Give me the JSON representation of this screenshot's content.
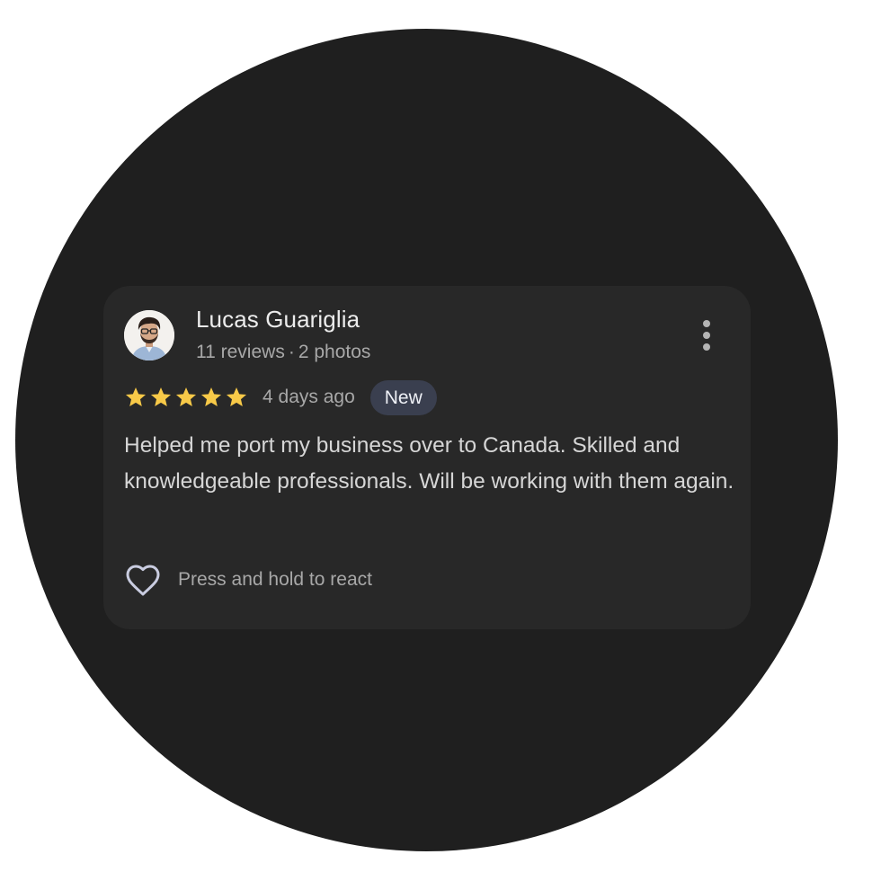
{
  "reviewer": {
    "name": "Lucas Guariglia",
    "reviews_count": "11 reviews",
    "separator": "·",
    "photos_count": "2 photos"
  },
  "rating": {
    "stars": 5,
    "max_stars": 5,
    "time_ago": "4 days ago",
    "badge": "New"
  },
  "review": {
    "text": "Helped me port my business over to Canada. Skilled and knowledgeable professionals. Will be working with them again."
  },
  "reaction": {
    "label": "Press and hold to react"
  },
  "icons": {
    "more": "more-vert-icon",
    "heart": "heart-outline-icon",
    "star": "star-filled-icon"
  },
  "colors": {
    "background": "#1f1f1f",
    "card": "#282828",
    "star": "#f7c948",
    "badge": "#3a3f4f"
  }
}
